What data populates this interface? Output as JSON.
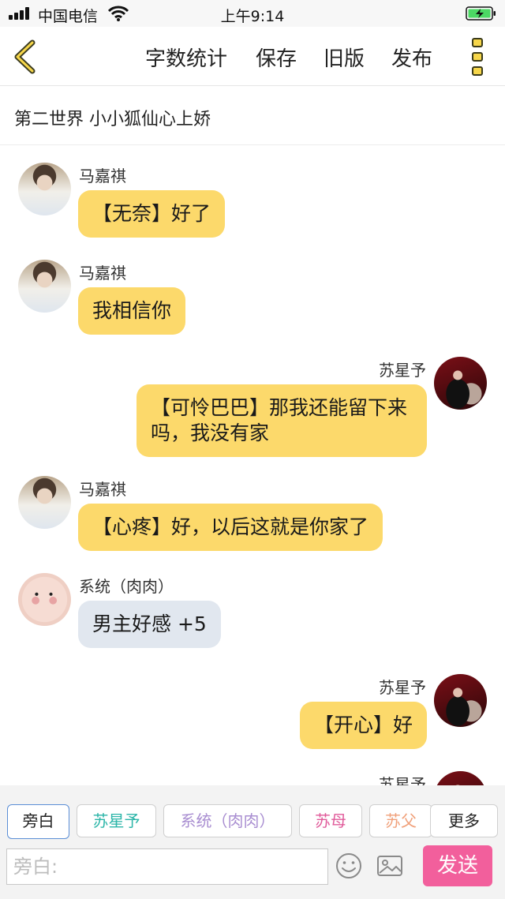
{
  "status_bar": {
    "carrier": "中国电信",
    "time": "上午9:14"
  },
  "toolbar": {
    "back_icon": "chevron-left-icon",
    "word_count": "字数统计",
    "save": "保存",
    "old_version": "旧版",
    "publish": "发布",
    "more_icon": "more-vertical-icon"
  },
  "title": "第二世界  小小狐仙心上娇",
  "messages": [
    {
      "sender": "马嘉祺",
      "side": "left",
      "text": "【无奈】好了",
      "color": "#fcd96b"
    },
    {
      "sender": "马嘉祺",
      "side": "left",
      "text": "我相信你",
      "color": "#fcd96b"
    },
    {
      "sender": "苏星予",
      "side": "right",
      "text": "【可怜巴巴】那我还能留下来吗，我没有家",
      "color": "#fcd96b"
    },
    {
      "sender": "马嘉祺",
      "side": "left",
      "text": "【心疼】好，以后这就是你家了",
      "color": "#fcd96b"
    },
    {
      "sender": "系统（肉肉）",
      "side": "left",
      "text": "男主好感 +5",
      "color": "#e1e7ef"
    },
    {
      "sender": "苏星予",
      "side": "right",
      "text": "【开心】好",
      "color": "#fcd96b"
    },
    {
      "sender": "苏星予",
      "side": "right",
      "text": "",
      "color": "#fcd96b"
    }
  ],
  "roles": [
    {
      "label": "旁白",
      "color": "#222222",
      "active": true
    },
    {
      "label": "苏星予",
      "color": "#2bb5a8",
      "active": false
    },
    {
      "label": "系统（肉肉）",
      "color": "#a98ed1",
      "active": false
    },
    {
      "label": "苏母",
      "color": "#e05a9a",
      "active": false
    },
    {
      "label": "苏父",
      "color": "#f0a07a",
      "active": false
    },
    {
      "label": "更多",
      "color": "#222222",
      "active": false
    }
  ],
  "composer": {
    "placeholder": "旁白:",
    "emoji_icon": "emoji-icon",
    "image_icon": "image-icon",
    "send": "发送",
    "send_color": "#f25f9c"
  }
}
